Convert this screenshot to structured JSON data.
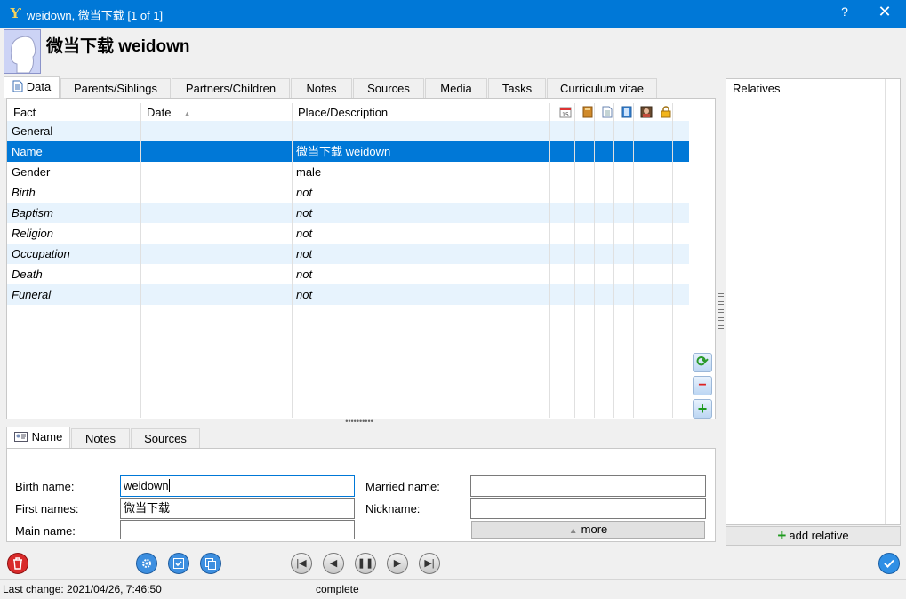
{
  "window": {
    "title": "weidown, 微当下载 [1 of 1]",
    "help": "?",
    "close": "✕"
  },
  "person": {
    "name": "微当下载 weidown"
  },
  "tabs": [
    {
      "label": "Data"
    },
    {
      "label": "Parents/Siblings"
    },
    {
      "label": "Partners/Children"
    },
    {
      "label": "Notes"
    },
    {
      "label": "Sources"
    },
    {
      "label": "Media"
    },
    {
      "label": "Tasks"
    },
    {
      "label": "Curriculum vitae"
    }
  ],
  "grid": {
    "columns": {
      "fact": "Fact",
      "date": "Date",
      "place": "Place/Description"
    },
    "sort_indicator": "▲",
    "rows": [
      {
        "fact": "General",
        "date": "",
        "place": ""
      },
      {
        "fact": "Name",
        "date": "",
        "place": "微当下载 weidown"
      },
      {
        "fact": "Gender",
        "date": "",
        "place": "male"
      },
      {
        "fact": "Birth",
        "date": "",
        "place": "not"
      },
      {
        "fact": "Baptism",
        "date": "",
        "place": "not"
      },
      {
        "fact": "Religion",
        "date": "",
        "place": "not"
      },
      {
        "fact": "Occupation",
        "date": "",
        "place": "not"
      },
      {
        "fact": "Death",
        "date": "",
        "place": "not"
      },
      {
        "fact": "Funeral",
        "date": "",
        "place": "not"
      }
    ]
  },
  "side_buttons": {
    "refresh": "⟳",
    "remove": "−",
    "add": "+"
  },
  "relatives": {
    "title": "Relatives",
    "add_label": "add relative"
  },
  "bottom_tabs": [
    {
      "label": "Name"
    },
    {
      "label": "Notes"
    },
    {
      "label": "Sources"
    }
  ],
  "name_form": {
    "birth_name_label": "Birth name:",
    "birth_name_value": "weidown",
    "first_names_label": "First names:",
    "first_names_value": "微当下载",
    "main_name_label": "Main name:",
    "main_name_value": "",
    "married_name_label": "Married name:",
    "married_name_value": "",
    "nickname_label": "Nickname:",
    "nickname_value": "",
    "more_label": "more"
  },
  "status": {
    "last_change": "Last change: 2021/04/26, 7:46:50",
    "completeness": "complete"
  },
  "colors": {
    "titlebar": "#0078d7",
    "selected_row": "#0078d7",
    "alt_row": "#e7f3fd"
  }
}
